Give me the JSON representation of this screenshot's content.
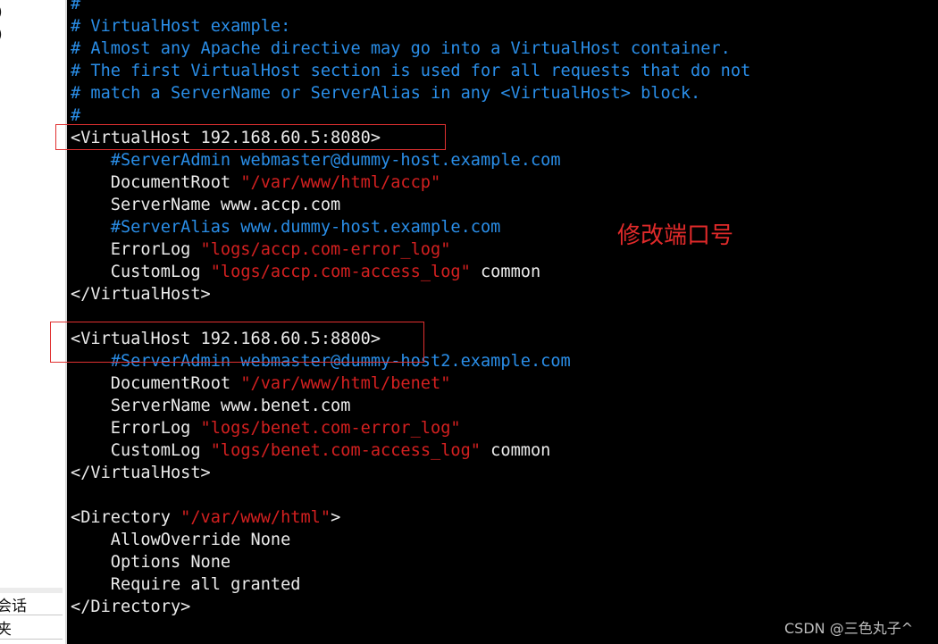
{
  "sidebar": {
    "items": [
      ")",
      ")",
      "会话",
      "夹"
    ]
  },
  "lines": [
    [
      {
        "t": "#",
        "k": "c"
      }
    ],
    [
      {
        "t": "# VirtualHost example:",
        "k": "c"
      }
    ],
    [
      {
        "t": "# Almost any Apache directive may go into a VirtualHost container.",
        "k": "c"
      }
    ],
    [
      {
        "t": "# The first VirtualHost section is used for all requests that do not",
        "k": "c"
      }
    ],
    [
      {
        "t": "# match a ServerName or ServerAlias in any <VirtualHost> block.",
        "k": "c"
      }
    ],
    [
      {
        "t": "#",
        "k": "c"
      }
    ],
    [
      {
        "t": "<VirtualHost 192.168.60.5:8080>",
        "k": "w"
      }
    ],
    [
      {
        "t": "    #ServerAdmin webmaster@dummy-host.example.com",
        "k": "c"
      }
    ],
    [
      {
        "t": "    DocumentRoot ",
        "k": "w"
      },
      {
        "t": "\"/var/www/html/accp\"",
        "k": "s"
      }
    ],
    [
      {
        "t": "    ServerName www.accp.com",
        "k": "w"
      }
    ],
    [
      {
        "t": "    #ServerAlias www.dummy-host.example.com",
        "k": "c"
      }
    ],
    [
      {
        "t": "    ErrorLog ",
        "k": "w"
      },
      {
        "t": "\"logs/accp.com-error_log\"",
        "k": "s"
      }
    ],
    [
      {
        "t": "    CustomLog ",
        "k": "w"
      },
      {
        "t": "\"logs/accp.com-access_log\"",
        "k": "s"
      },
      {
        "t": " common",
        "k": "w"
      }
    ],
    [
      {
        "t": "</VirtualHost>",
        "k": "w"
      }
    ],
    [],
    [
      {
        "t": "<VirtualHost 192.168.60.5:8800>",
        "k": "w"
      }
    ],
    [
      {
        "t": "    #ServerAdmin webmaster@dummy-host2.example.com",
        "k": "c"
      }
    ],
    [
      {
        "t": "    DocumentRoot ",
        "k": "w"
      },
      {
        "t": "\"/var/www/html/benet\"",
        "k": "s"
      }
    ],
    [
      {
        "t": "    ServerName www.benet.com",
        "k": "w"
      }
    ],
    [
      {
        "t": "    ErrorLog ",
        "k": "w"
      },
      {
        "t": "\"logs/benet.com-error_log\"",
        "k": "s"
      }
    ],
    [
      {
        "t": "    CustomLog ",
        "k": "w"
      },
      {
        "t": "\"logs/benet.com-access_log\"",
        "k": "s"
      },
      {
        "t": " common",
        "k": "w"
      }
    ],
    [
      {
        "t": "</VirtualHost>",
        "k": "w"
      }
    ],
    [],
    [
      {
        "t": "<Directory ",
        "k": "w"
      },
      {
        "t": "\"/var/www/html\"",
        "k": "s"
      },
      {
        "t": ">",
        "k": "w"
      }
    ],
    [
      {
        "t": "    AllowOverride None",
        "k": "w"
      }
    ],
    [
      {
        "t": "    Options None",
        "k": "w"
      }
    ],
    [
      {
        "t": "    Require all granted",
        "k": "w"
      }
    ],
    [
      {
        "t": "</Directory>",
        "k": "w"
      }
    ]
  ],
  "annotation": "修改端口号",
  "watermark": "CSDN @三色丸子^",
  "colors": {
    "comment": "#2a8ee8",
    "string": "#d42020",
    "text": "#e8e8e8",
    "highlight_box": "#e03030"
  }
}
